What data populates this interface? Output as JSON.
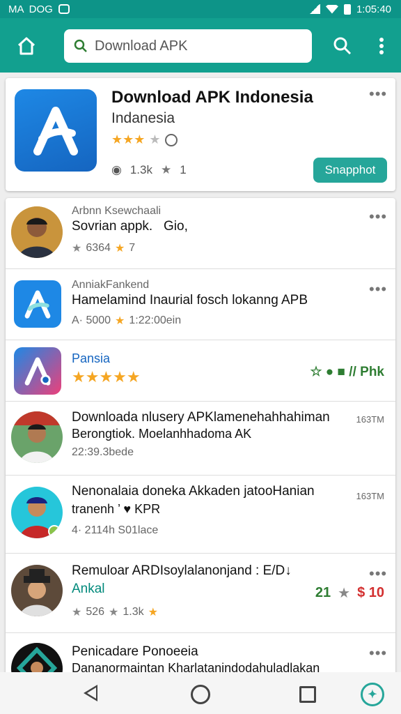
{
  "status_bar": {
    "time_left": "MA  DOG",
    "time_right": "1:05:40"
  },
  "search": {
    "value": "Download APK",
    "placeholder": "Download APK"
  },
  "featured": {
    "title": "Download APK Indonesia",
    "subtitle": "Indanesia",
    "stars": "★★★",
    "star_dim": "★",
    "views": "1.3k",
    "likes": "1",
    "button_label": "Snapphot"
  },
  "rows": [
    {
      "top": "Arbnn Ksewchaali",
      "title": "Sovrian appk.   Gio,",
      "meta_a": "6364",
      "meta_b": "7"
    },
    {
      "top": "AnniakFankend",
      "title": "Hamelamind Inaurial fosch lokanng APB",
      "meta_a": "A· 5000",
      "meta_b": "1:22:00ein"
    },
    {
      "top": "Pansia",
      "title": "★★★★★",
      "right": "☆ ● ■ // Phk"
    },
    {
      "title": "Downloada nlusery APKlamenehahhahiman",
      "sub": "Berongtiok. Moelanhhadoma AK",
      "meta": "22:39.3bede",
      "right": "163TM"
    },
    {
      "title": "Nenonalaia doneka Akkaden jatooHanian",
      "sub": "tranenh ’ ♥ KPR",
      "meta": "4· 2114h S01lace",
      "right": "163TM"
    },
    {
      "title": "Remuloar ARDIsoylalanonjand : E/D↓",
      "sub": "Ankal",
      "meta_a": "526",
      "meta_b": "1.3k",
      "right_a": "21",
      "right_b": "$ 10"
    },
    {
      "title": "Penicadare Ponoeeia",
      "sub": "Dananormaintan Kharlatanindodahuladlakan"
    }
  ],
  "colors": {
    "toolbar": "#12a08f",
    "accent": "#26a69a",
    "star": "#f5a623"
  },
  "icons": [
    "home-icon",
    "search-icon",
    "more-vert-icon",
    "back-icon",
    "home-nav-icon",
    "recents-icon",
    "app-logo-icon"
  ]
}
